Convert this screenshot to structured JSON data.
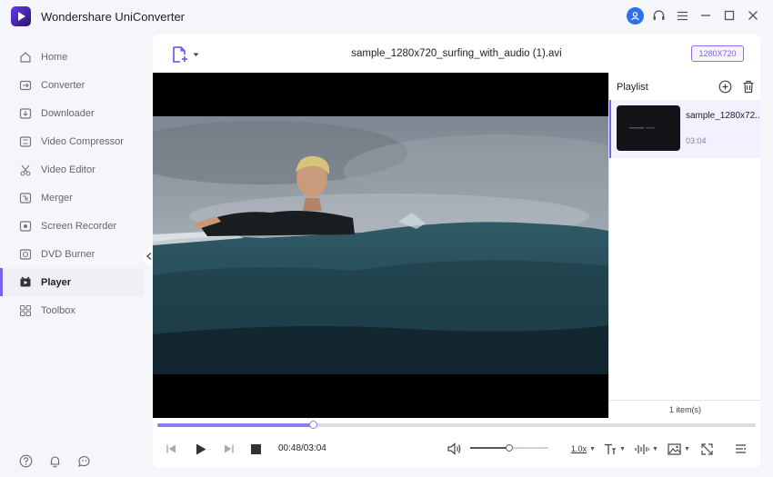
{
  "app": {
    "title": "Wondershare UniConverter"
  },
  "sidebar": {
    "items": [
      {
        "label": "Home",
        "icon": "home-icon"
      },
      {
        "label": "Converter",
        "icon": "converter-icon"
      },
      {
        "label": "Downloader",
        "icon": "downloader-icon"
      },
      {
        "label": "Video Compressor",
        "icon": "compressor-icon"
      },
      {
        "label": "Video Editor",
        "icon": "scissors-icon"
      },
      {
        "label": "Merger",
        "icon": "merger-icon"
      },
      {
        "label": "Screen Recorder",
        "icon": "screen-recorder-icon"
      },
      {
        "label": "DVD Burner",
        "icon": "dvd-icon"
      },
      {
        "label": "Player",
        "icon": "player-icon",
        "active": true
      },
      {
        "label": "Toolbox",
        "icon": "toolbox-icon"
      }
    ]
  },
  "player": {
    "file_name": "sample_1280x720_surfing_with_audio (1).avi",
    "resolution": "1280X720",
    "current_time": "00:48",
    "total_time": "03:04",
    "time_display": "00:48/03:04",
    "progress": 0.26,
    "volume": 0.5,
    "speed": "1.0x"
  },
  "playlist": {
    "title": "Playlist",
    "items": [
      {
        "name": "sample_1280x72...",
        "duration": "03:04"
      }
    ],
    "count_label": "1 item(s)"
  },
  "colors": {
    "accent": "#7b5ff0",
    "avatar": "#2f6ef0"
  }
}
